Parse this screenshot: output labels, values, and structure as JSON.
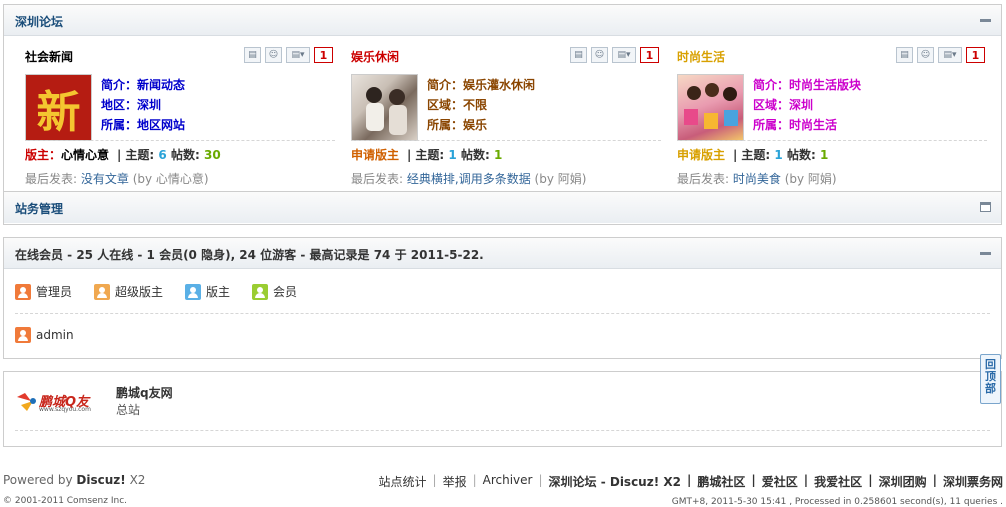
{
  "category": {
    "title": "深圳论坛",
    "forums": [
      {
        "name": "社会新闻",
        "intro_label": "简介：",
        "intro": "新闻动态",
        "region_label": "地区：",
        "region": "深圳",
        "belong_label": "所属：",
        "belong": "地区网站",
        "mod_label": "版主：",
        "mod": "心情心意",
        "threads_label": "主题:",
        "threads": "6",
        "posts_label": "帖数:",
        "posts": "30",
        "last_label": "最后发表:",
        "last_post": "没有文章",
        "last_by": "(by 心情心意)",
        "badge": "1",
        "thumb_char": "新"
      },
      {
        "name": "娱乐休闲",
        "intro_label": "简介：",
        "intro": "娱乐灌水休闲",
        "region_label": "区域：",
        "region": "不限",
        "belong_label": "所属：",
        "belong": "娱乐",
        "mod_label": "申请版主",
        "threads_label": "主题:",
        "threads": "1",
        "posts_label": "帖数:",
        "posts": "1",
        "last_label": "最后发表:",
        "last_post": "经典横排,调用多条数据",
        "last_by": "(by 阿娟)",
        "badge": "1"
      },
      {
        "name": "时尚生活",
        "intro_label": "简介：",
        "intro": "时尚生活版块",
        "region_label": "区域：",
        "region": "深圳",
        "belong_label": "所属：",
        "belong": "时尚生活",
        "mod_label": "申请版主",
        "threads_label": "主题:",
        "threads": "1",
        "posts_label": "帖数:",
        "posts": "1",
        "last_label": "最后发表:",
        "last_post": "时尚美食",
        "last_by": "(by 阿娟)",
        "badge": "1"
      }
    ]
  },
  "admin_section": {
    "title": "站务管理"
  },
  "online": {
    "title": "在线会员 - 25 人在线 - 1 会员(0 隐身), 24 位游客 - 最高记录是 74 于 2011-5-22.",
    "legend": [
      {
        "label": "管理员",
        "color": "#f07a3a"
      },
      {
        "label": "超级版主",
        "color": "#f0a850"
      },
      {
        "label": "版主",
        "color": "#5ab0e6"
      },
      {
        "label": "会员",
        "color": "#9acd32"
      }
    ],
    "users": [
      {
        "name": "admin",
        "color": "#f07a3a"
      }
    ]
  },
  "links": {
    "logo_text": "鹏城Q友",
    "logo_url": "www.szqyou.com",
    "name": "鹏城q友网",
    "desc": "总站"
  },
  "to_top": "回顶部",
  "footer": {
    "powered_prefix": "Powered by",
    "powered_name": "Discuz!",
    "powered_version": "X2",
    "nav": [
      "站点统计",
      "举报",
      "Archiver"
    ],
    "bold_nav": [
      "深圳论坛 - Discuz! X2",
      "鹏城社区",
      "爱社区",
      "我爱社区",
      "深圳团购",
      "深圳票务网"
    ],
    "copyright": "© 2001-2011 Comsenz Inc.",
    "debug": "GMT+8, 2011-5-30 15:41 , Processed in 0.258601 second(s), 11 queries ."
  }
}
